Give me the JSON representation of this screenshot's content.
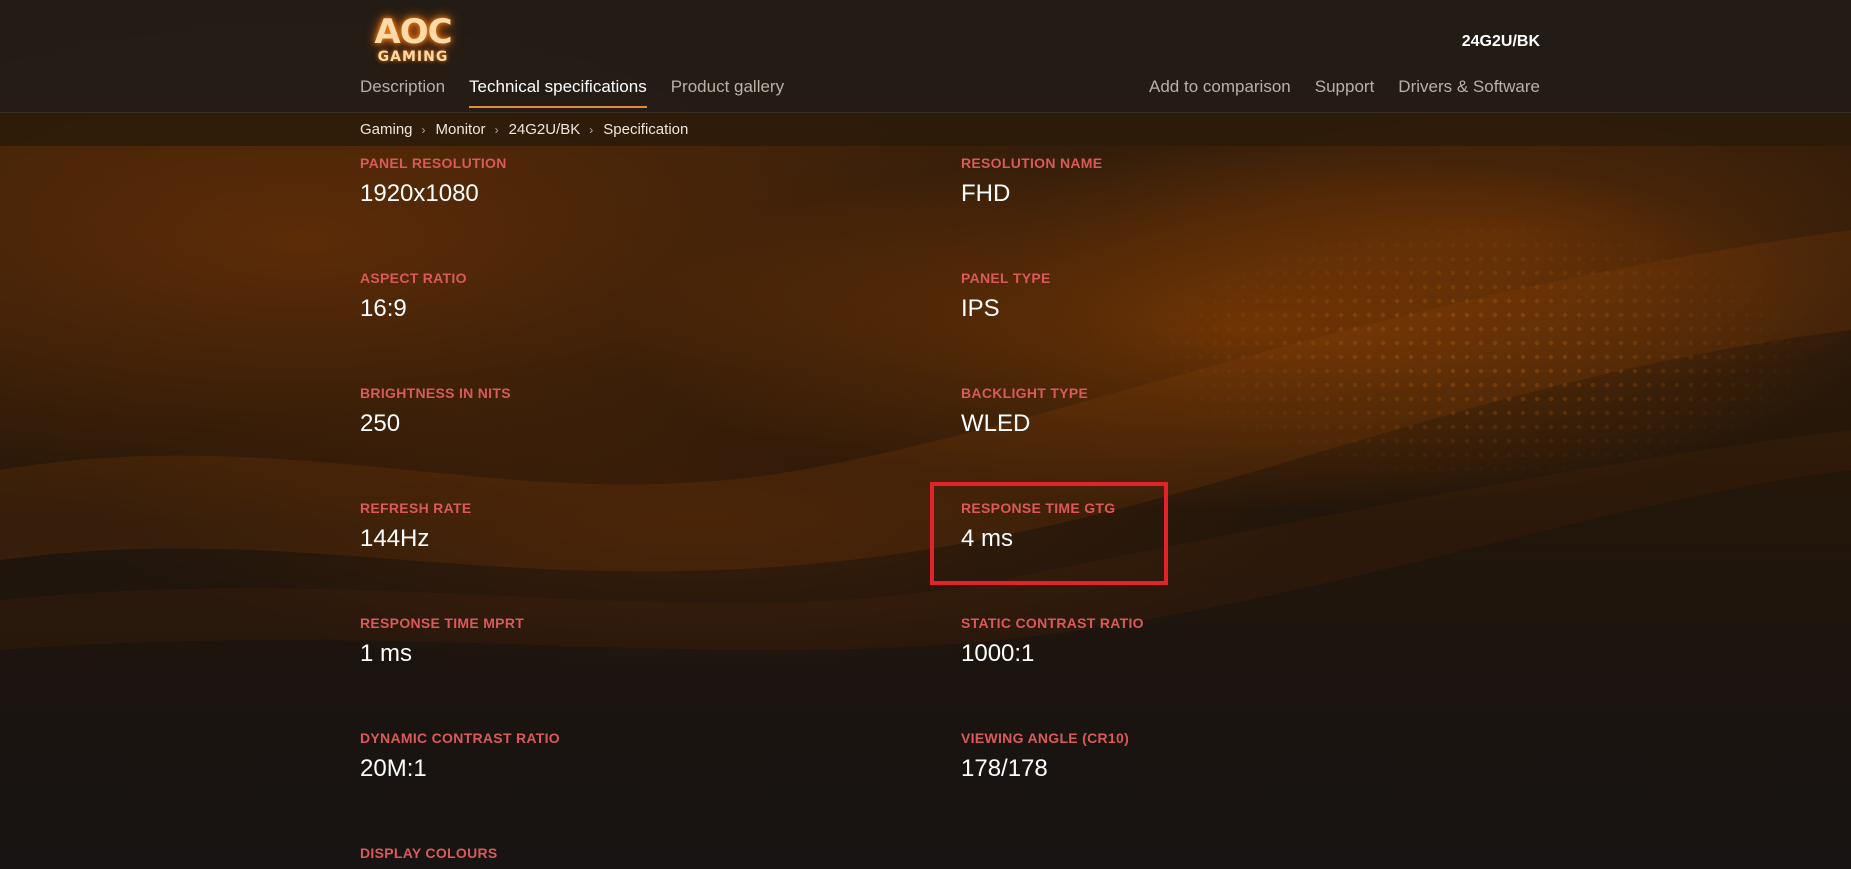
{
  "header": {
    "logo": {
      "brand": "AOC",
      "sub": "GAMING"
    },
    "model": "24G2U/BK",
    "nav_left": [
      {
        "label": "Description",
        "active": false
      },
      {
        "label": "Technical specifications",
        "active": true
      },
      {
        "label": "Product gallery",
        "active": false
      }
    ],
    "nav_right": [
      {
        "label": "Add to comparison"
      },
      {
        "label": "Support"
      },
      {
        "label": "Drivers & Software"
      }
    ]
  },
  "breadcrumb": [
    "Gaming",
    "Monitor",
    "24G2U/BK",
    "Specification"
  ],
  "specs": [
    {
      "label": "PANEL RESOLUTION",
      "value": "1920x1080"
    },
    {
      "label": "RESOLUTION NAME",
      "value": "FHD"
    },
    {
      "label": "ASPECT RATIO",
      "value": "16:9"
    },
    {
      "label": "PANEL TYPE",
      "value": "IPS"
    },
    {
      "label": "BRIGHTNESS IN NITS",
      "value": "250"
    },
    {
      "label": "BACKLIGHT TYPE",
      "value": "WLED"
    },
    {
      "label": "REFRESH RATE",
      "value": "144Hz"
    },
    {
      "label": "RESPONSE TIME GTG",
      "value": "4 ms"
    },
    {
      "label": "RESPONSE TIME MPRT",
      "value": "1 ms"
    },
    {
      "label": "STATIC CONTRAST RATIO",
      "value": "1000:1"
    },
    {
      "label": "DYNAMIC CONTRAST RATIO",
      "value": "20M:1"
    },
    {
      "label": "VIEWING ANGLE (CR10)",
      "value": "178/178"
    },
    {
      "label": "DISPLAY COLOURS",
      "value": ""
    }
  ],
  "colors": {
    "accent": "#e98a3a",
    "label": "#d85a5a",
    "highlight": "#e3232c"
  }
}
